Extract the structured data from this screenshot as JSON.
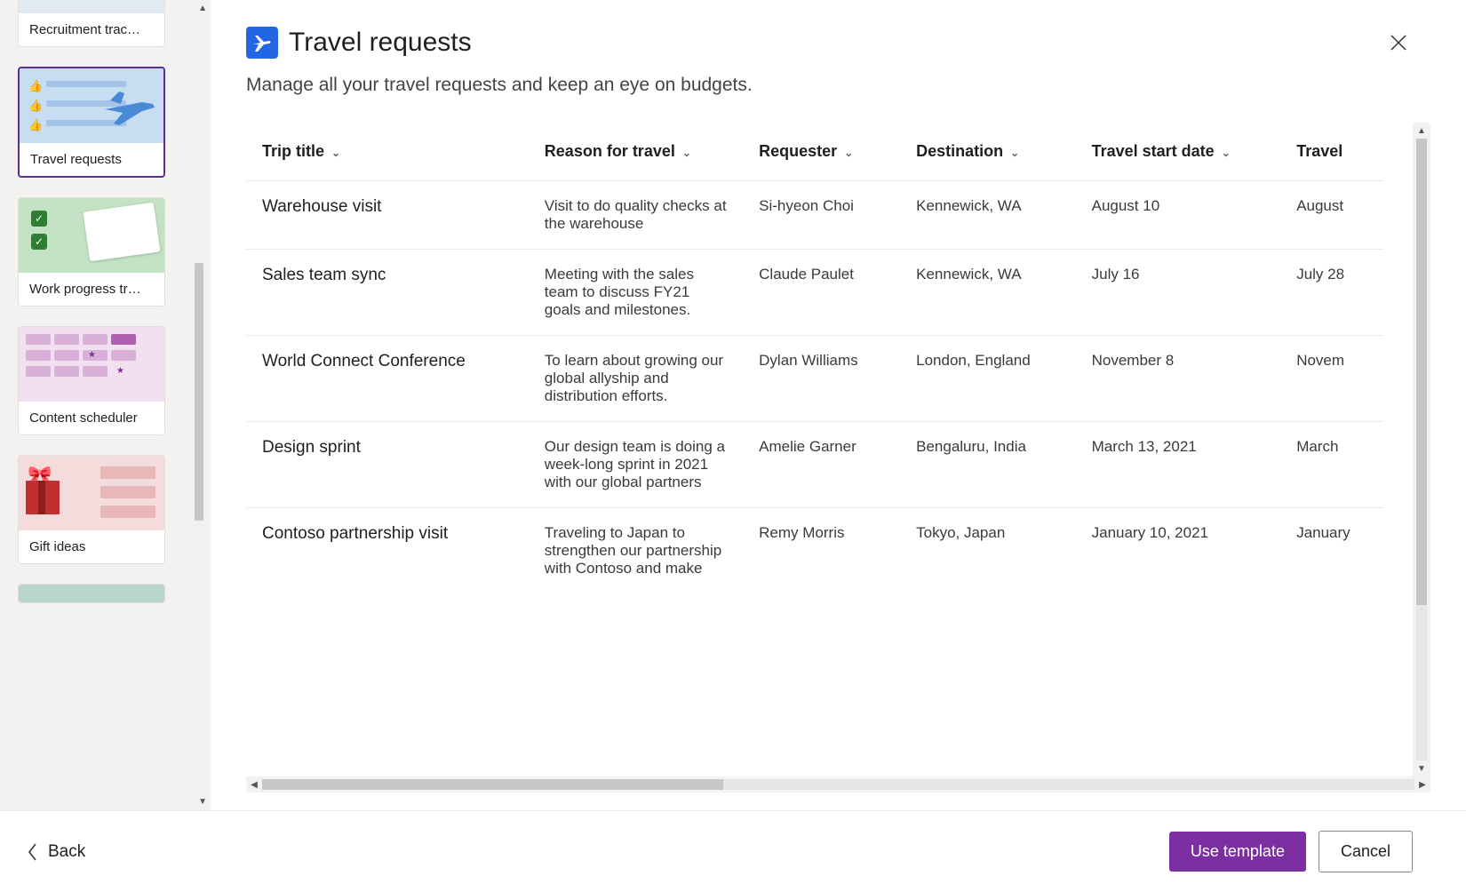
{
  "sidebar": {
    "templates": [
      {
        "label": "Recruitment trac…"
      },
      {
        "label": "Travel requests"
      },
      {
        "label": "Work progress tr…"
      },
      {
        "label": "Content scheduler"
      },
      {
        "label": "Gift ideas"
      }
    ]
  },
  "header": {
    "title": "Travel requests",
    "description": "Manage all your travel requests and keep an eye on budgets."
  },
  "table": {
    "columns": [
      "Trip title",
      "Reason for travel",
      "Requester",
      "Destination",
      "Travel start date",
      "Travel"
    ],
    "rows": [
      {
        "title": "Warehouse visit",
        "reason": "Visit to do quality checks at the warehouse",
        "requester": "Si-hyeon Choi",
        "destination": "Kennewick, WA",
        "start": "August 10",
        "end": "August"
      },
      {
        "title": "Sales team sync",
        "reason": "Meeting with the sales team to discuss FY21 goals and milestones.",
        "requester": "Claude Paulet",
        "destination": "Kennewick, WA",
        "start": "July 16",
        "end": "July 28"
      },
      {
        "title": "World Connect Conference",
        "reason": "To learn about growing our global allyship and distribution efforts.",
        "requester": "Dylan Williams",
        "destination": "London, England",
        "start": "November 8",
        "end": "Novem"
      },
      {
        "title": "Design sprint",
        "reason": "Our design team is doing a week-long sprint in 2021 with our global partners",
        "requester": "Amelie Garner",
        "destination": "Bengaluru, India",
        "start": "March 13, 2021",
        "end": "March"
      },
      {
        "title": "Contoso partnership visit",
        "reason": "Traveling to Japan to strengthen our partnership with Contoso and make",
        "requester": "Remy Morris",
        "destination": "Tokyo, Japan",
        "start": "January 10, 2021",
        "end": "January"
      }
    ]
  },
  "footer": {
    "back": "Back",
    "use_template": "Use template",
    "cancel": "Cancel"
  }
}
